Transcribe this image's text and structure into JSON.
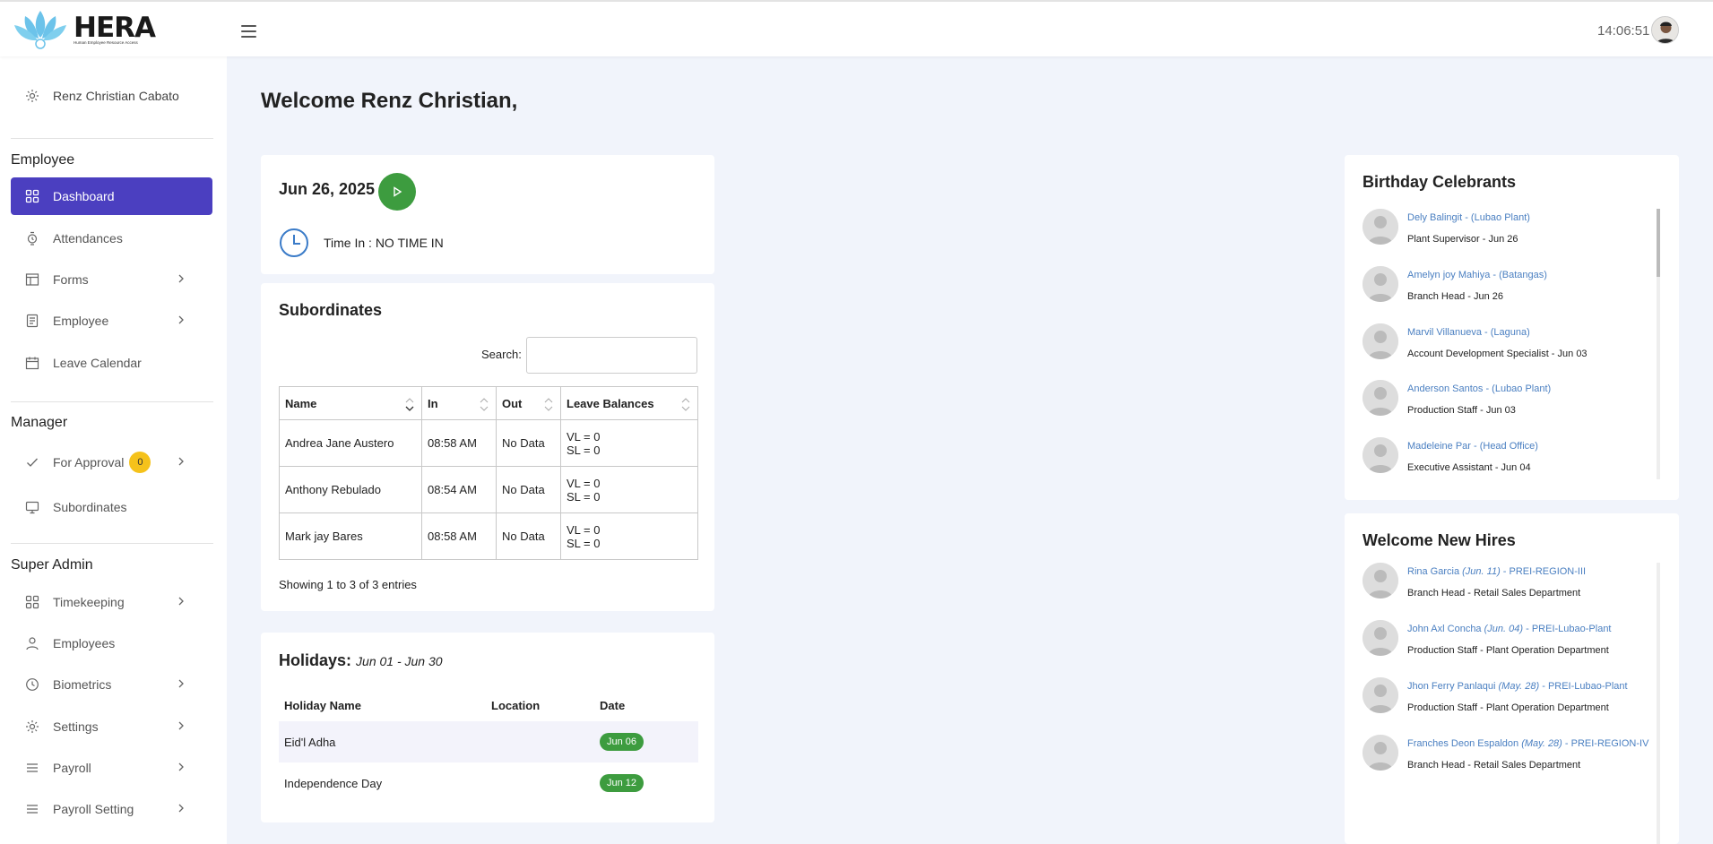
{
  "header": {
    "logo_word": "HERA",
    "logo_tagline": "Human Employee Resource Access",
    "clock": "14:06:51"
  },
  "sidebar": {
    "user_name": "Renz Christian Cabato",
    "sections": {
      "employee": "Employee",
      "manager": "Manager",
      "super_admin": "Super Admin"
    },
    "items": [
      {
        "label": "Dashboard"
      },
      {
        "label": "Attendances"
      },
      {
        "label": "Forms"
      },
      {
        "label": "Employee"
      },
      {
        "label": "Leave Calendar"
      },
      {
        "label": "For Approval",
        "count": "0"
      },
      {
        "label": "Subordinates"
      },
      {
        "label": "Timekeeping"
      },
      {
        "label": "Employees"
      },
      {
        "label": "Biometrics"
      },
      {
        "label": "Settings"
      },
      {
        "label": "Payroll"
      },
      {
        "label": "Payroll Setting"
      }
    ]
  },
  "main": {
    "welcome": "Welcome Renz Christian,",
    "date_card": {
      "date": "Jun 26, 2025",
      "time_in": "Time In : NO TIME IN"
    },
    "subordinates": {
      "title": "Subordinates",
      "search_label": "Search:",
      "columns": [
        "Name",
        "In",
        "Out",
        "Leave Balances"
      ],
      "rows": [
        {
          "name": "Andrea Jane Austero",
          "in": "08:58 AM",
          "out": "No Data",
          "vl": "VL = 0",
          "sl": "SL = 0"
        },
        {
          "name": "Anthony Rebulado",
          "in": "08:54 AM",
          "out": "No Data",
          "vl": "VL = 0",
          "sl": "SL = 0"
        },
        {
          "name": "Mark jay Bares",
          "in": "08:58 AM",
          "out": "No Data",
          "vl": "VL = 0",
          "sl": "SL = 0"
        }
      ],
      "showing": "Showing 1 to 3 of 3 entries"
    },
    "holidays": {
      "title": "Holidays:",
      "range": "Jun 01 - Jun 30",
      "columns": [
        "Holiday Name",
        "Location",
        "Date"
      ],
      "rows": [
        {
          "name": "Eid'l Adha",
          "location": "",
          "date": "Jun 06"
        },
        {
          "name": "Independence Day",
          "location": "",
          "date": "Jun 12"
        }
      ]
    }
  },
  "birthdays": {
    "title": "Birthday Celebrants",
    "people": [
      {
        "name": "Dely Balingit - (Lubao Plant)",
        "role": "Plant Supervisor - Jun 26"
      },
      {
        "name": "Amelyn joy Mahiya - (Batangas)",
        "role": "Branch Head - Jun 26"
      },
      {
        "name": "Marvil Villanueva - (Laguna)",
        "role": "Account Development Specialist - Jun 03"
      },
      {
        "name": "Anderson Santos - (Lubao Plant)",
        "role": "Production Staff - Jun 03"
      },
      {
        "name": "Madeleine Par - (Head Office)",
        "role": "Executive Assistant - Jun 04"
      }
    ]
  },
  "new_hires": {
    "title": "Welcome New Hires",
    "people": [
      {
        "name": "Rina Garcia",
        "date": "(Jun. 11)",
        "branch": "PREI-REGION-III",
        "role": "Branch Head - Retail Sales Department"
      },
      {
        "name": "John Axl Concha",
        "date": "(Jun. 04)",
        "branch": "PREI-Lubao-Plant",
        "role": "Production Staff - Plant Operation Department"
      },
      {
        "name": "Jhon Ferry Panlaqui",
        "date": "(May. 28)",
        "branch": "PREI-Lubao-Plant",
        "role": "Production Staff - Plant Operation Department"
      },
      {
        "name": "Franches Deon Espaldon",
        "date": "(May. 28)",
        "branch": "PREI-REGION-IV",
        "role": "Branch Head - Retail Sales Department"
      }
    ]
  },
  "colors": {
    "primary": "#4b3fc0",
    "success": "#3d9c3f",
    "badge": "#f5c21b",
    "link": "#4a7fc1",
    "logo_blue": "#6cc3ea"
  }
}
